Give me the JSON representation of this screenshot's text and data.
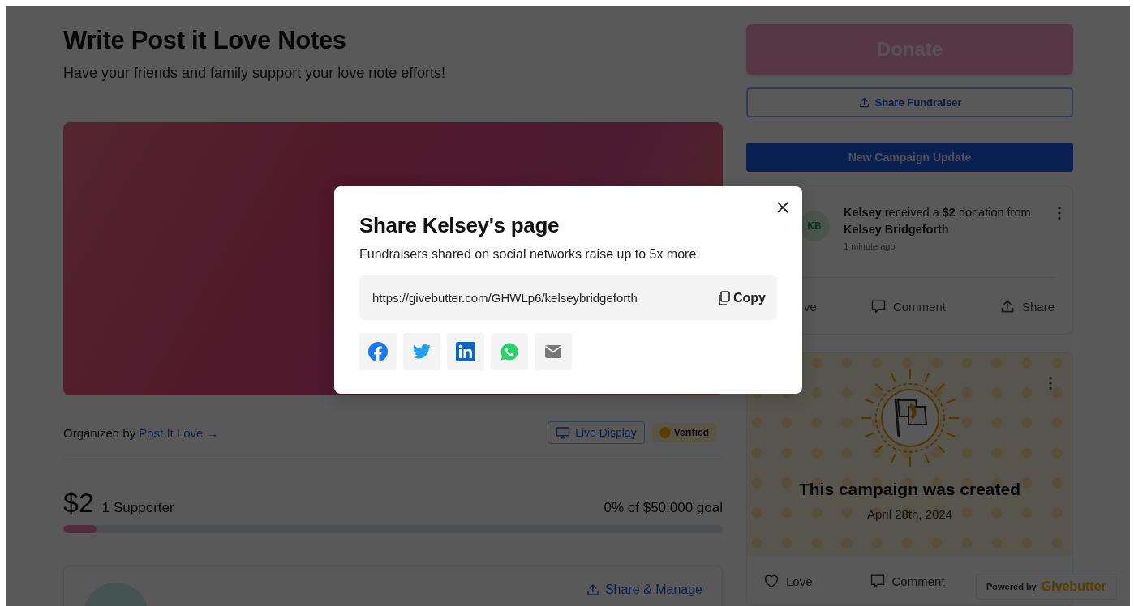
{
  "campaign": {
    "title": "Write Post it Love Notes",
    "subtitle": "Have your friends and family support your love note efforts!",
    "organizer": {
      "prefix": "Organized by",
      "name": "Post It Love →"
    },
    "live_display": "Live Display",
    "verified": "Verified",
    "progress": {
      "raised": "$2",
      "supporters": "1 Supporter",
      "goal": "0% of $50,000 goal",
      "level": 0.05
    },
    "team_card": {
      "action": "Share & Manage"
    }
  },
  "sidebar": {
    "donate": "Donate",
    "share": "Share Fundraiser",
    "update": "New Campaign Update",
    "feed": [
      {
        "kind": "donation",
        "avatar": "KB",
        "text": "**Kelsey** received a **$2** donation from **Kelsey Bridgeforth**",
        "time": "1 minute ago",
        "actions": [
          {
            "kind": "partial",
            "label": "ve"
          },
          {
            "kind": "comment",
            "label": "Comment"
          },
          {
            "kind": "share",
            "label": "Share"
          }
        ]
      },
      {
        "kind": "milestone",
        "title": "This campaign was created",
        "date": "April 28th, 2024",
        "actions": [
          {
            "kind": "love",
            "label": "Love"
          },
          {
            "kind": "comment",
            "label": "Comment"
          }
        ]
      }
    ]
  },
  "badge": {
    "prefix": "Powered by",
    "brand": "Givebutter"
  },
  "modal": {
    "title": "Share Kelsey's page",
    "subtitle": "Fundraisers shared on social networks raise up to 5x more.",
    "url": "https://givebutter.com/GHWLp6/kelseybridgeforth",
    "copy": "Copy",
    "networks": [
      {
        "kind": "facebook"
      },
      {
        "kind": "twitter"
      },
      {
        "kind": "linkedin"
      },
      {
        "kind": "whatsapp"
      },
      {
        "kind": "email"
      }
    ]
  }
}
